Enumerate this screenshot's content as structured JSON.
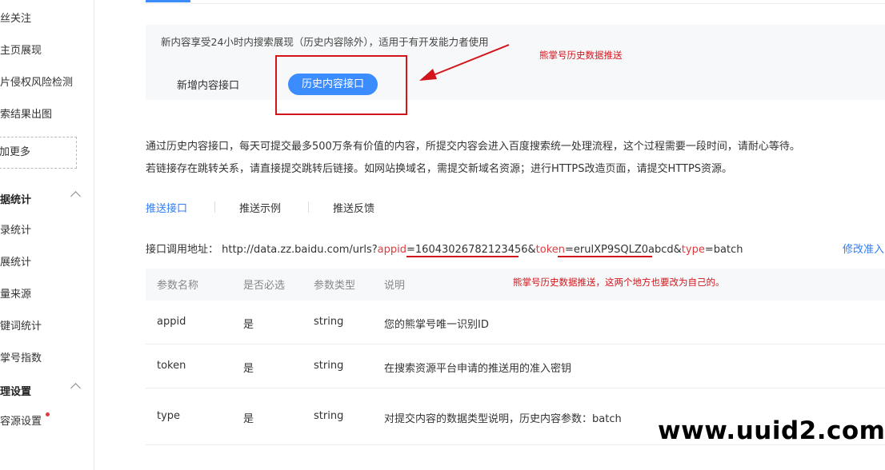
{
  "sidebar": {
    "items_top": [
      "丝关注",
      "主页展现",
      "片侵权风险检测",
      "索结果出图"
    ],
    "more_label": "加更多",
    "group_data": "据统计",
    "data_items": [
      "录统计",
      "展统计",
      "量来源",
      "键词统计",
      "掌号指数"
    ],
    "group_manage": "理设置",
    "manage_items": [
      "容源设置"
    ]
  },
  "intro": {
    "text": "新内容享受24小时内搜索展现（历史内容除外），适用于有开发能力者使用",
    "tab_new": "新增内容接口",
    "tab_history": "历史内容接口"
  },
  "annotations": {
    "arrow_note": "熊掌号历史数据推送",
    "table_note": "熊掌号历史数据推送，这两个地方也要改为自己的。"
  },
  "description": {
    "line1": "通过历史内容接口，每天可提交最多500万条有价值的内容，所提交内容会进入百度搜索统一处理流程，这个过程需要一段时间，请耐心等待。",
    "line2": "若链接存在跳转关系，请直接提交跳转后链接。如网站换域名，需提交新域名资源；进行HTTPS改造页面，请提交HTTPS资源。"
  },
  "subnav": {
    "push_api": "推送接口",
    "push_example": "推送示例",
    "push_feedback": "推送反馈"
  },
  "api": {
    "label": "接口调用地址：",
    "url_base": "http://data.zz.baidu.com/urls?",
    "k_appid": "appid",
    "eq": "=",
    "v_appid": "1604302678212345​6",
    "amp": "&",
    "k_token": "token",
    "v_token": "erulXP9SQLZ0abcd",
    "k_type": "type",
    "v_type": "batch",
    "edit_label": "修改准入"
  },
  "table": {
    "headers": [
      "参数名称",
      "是否必选",
      "参数类型",
      "说明"
    ],
    "rows": [
      {
        "name": "appid",
        "required": "是",
        "type": "string",
        "desc": "您的熊掌号唯一识别ID"
      },
      {
        "name": "token",
        "required": "是",
        "type": "string",
        "desc": "在搜索资源平台申请的推送用的准入密钥"
      },
      {
        "name": "type",
        "required": "是",
        "type": "string",
        "desc": "对提交内容的数据类型说明，历史内容参数：batch"
      }
    ]
  },
  "watermark": "www.uuid2.com",
  "colors": {
    "accent": "#3b8cff",
    "annotation_red": "#d2151a",
    "keyword_red": "#e0393e"
  }
}
